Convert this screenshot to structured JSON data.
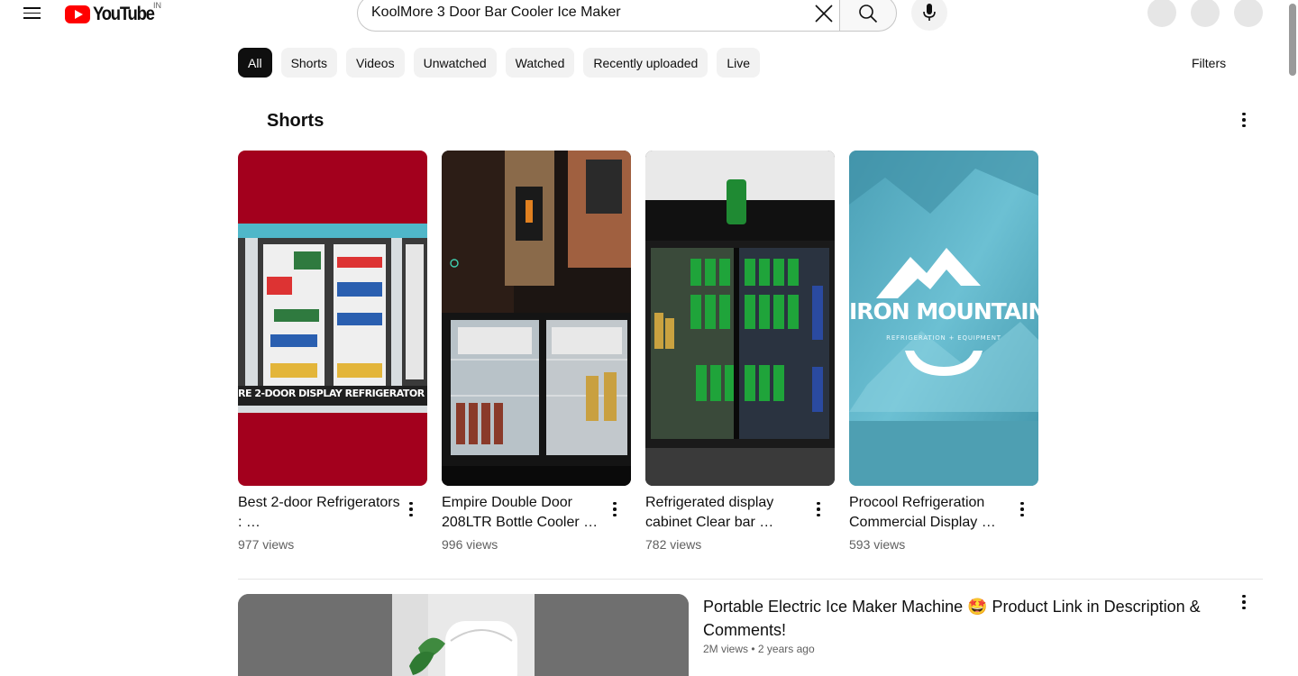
{
  "header": {
    "logo_text": "YouTube",
    "country_code": "IN",
    "search_value": "KoolMore 3 Door Bar Cooler Ice Maker",
    "brand_color": "#ff0000"
  },
  "chips": [
    "All",
    "Shorts",
    "Videos",
    "Unwatched",
    "Watched",
    "Recently uploaded",
    "Live"
  ],
  "filters_label": "Filters",
  "shorts": {
    "title": "Shorts",
    "items": [
      {
        "title": "Best 2-door Refrigerators : …",
        "views": "977 views",
        "overlay_text": "RE 2-DOOR DISPLAY REFRIGERATOR"
      },
      {
        "title": "Empire Double Door 208LTR Bottle Cooler …",
        "views": "996 views"
      },
      {
        "title": "Refrigerated display cabinet Clear bar …",
        "views": "782 views"
      },
      {
        "title": "Procool Refrigeration Commercial Display …",
        "views": "593 views",
        "overlay_text": "IRON MOUNTAIN",
        "overlay_subtext": "REFRIGERATION + EQUIPMENT"
      }
    ]
  },
  "video": {
    "title": "Portable Electric Ice Maker Machine 🤩 Product Link in Description & Comments!",
    "views": "2M views",
    "age": "2 years ago"
  }
}
